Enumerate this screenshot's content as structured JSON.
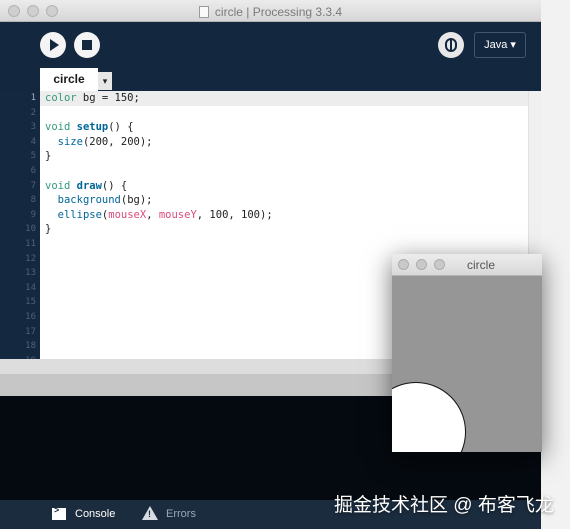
{
  "window": {
    "title": "circle | Processing 3.3.4"
  },
  "toolbar": {
    "run_icon": "play-icon",
    "stop_icon": "stop-icon",
    "debug_icon": "debugger-icon",
    "mode_label": "Java ▾"
  },
  "tabs": [
    {
      "label": "circle"
    }
  ],
  "tab_menu_label": "▾",
  "editor": {
    "line_numbers": [
      "1",
      "2",
      "3",
      "4",
      "5",
      "6",
      "7",
      "8",
      "9",
      "10",
      "11",
      "12",
      "13",
      "14",
      "15",
      "16",
      "17",
      "18",
      "19"
    ],
    "lines": [
      "color bg = 150;",
      "",
      "void setup() {",
      "  size(200, 200);",
      "}",
      "",
      "void draw() {",
      "  background(bg);",
      "  ellipse(mouseX, mouseY, 100, 100);",
      "}"
    ]
  },
  "footer": {
    "console_label": "Console",
    "errors_label": "Errors"
  },
  "sketch_window": {
    "title": "circle"
  },
  "colors": {
    "ide_background": "#0f1c2a",
    "toolbar_background": "#13283f",
    "sketch_background": "#969696"
  },
  "watermark": "掘金技术社区 @ 布客飞龙"
}
